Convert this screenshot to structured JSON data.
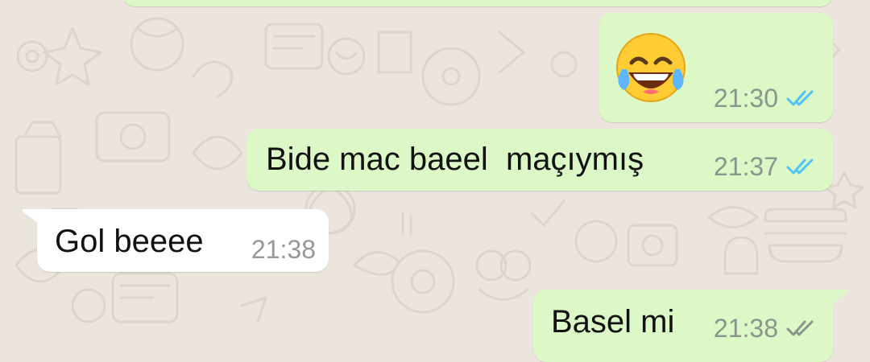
{
  "chat": {
    "messages": [
      {
        "id": "m1",
        "direction": "outgoing",
        "kind": "emoji",
        "emoji_name": "face-with-tears-of-joy",
        "time": "21:30",
        "status": "read"
      },
      {
        "id": "m2",
        "direction": "outgoing",
        "kind": "text",
        "text": "Bide mac baeel  maçıymış",
        "time": "21:37",
        "status": "read"
      },
      {
        "id": "m3",
        "direction": "incoming",
        "kind": "text",
        "text": "Gol beeee",
        "time": "21:38"
      },
      {
        "id": "m4",
        "direction": "outgoing",
        "kind": "text",
        "text": "Basel mi",
        "time": "21:38",
        "status": "delivered"
      }
    ]
  },
  "colors": {
    "background": "#ece5dd",
    "outgoing_bubble": "#dcf8c6",
    "incoming_bubble": "#ffffff",
    "read_tick": "#4fc3f7",
    "delivered_tick": "#8a958c"
  }
}
